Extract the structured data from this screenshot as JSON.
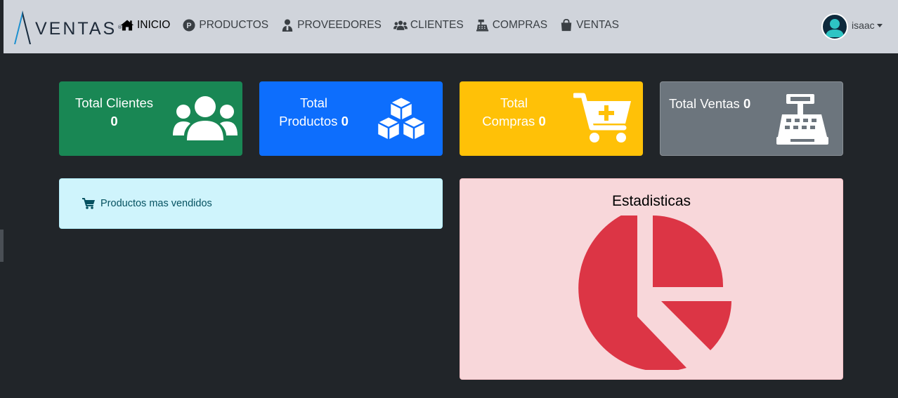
{
  "brand": {
    "name": "VENTAS",
    "registered": "®"
  },
  "nav": {
    "items": [
      {
        "label": "INICIO",
        "icon": "home-icon"
      },
      {
        "label": "PRODUCTOS",
        "icon": "product-p-icon"
      },
      {
        "label": "PROVEEDORES",
        "icon": "supplier-icon"
      },
      {
        "label": "CLIENTES",
        "icon": "users-icon"
      },
      {
        "label": "COMPRAS",
        "icon": "cash-register-icon"
      },
      {
        "label": "VENTAS",
        "icon": "shopping-bag-icon"
      }
    ]
  },
  "user": {
    "name": "isaac"
  },
  "cards": {
    "clientes": {
      "line1": "Total Clientes",
      "value": "0",
      "color": "#198754",
      "icon": "users-icon"
    },
    "productos": {
      "line1": "Total",
      "line2": "Productos",
      "value": "0",
      "color": "#0d6efd",
      "icon": "cubes-icon"
    },
    "compras": {
      "line1": "Total",
      "line2": "Compras",
      "value": "0",
      "color": "#ffc107",
      "icon": "cart-plus-icon"
    },
    "ventas": {
      "line1": "Total Ventas",
      "value": "0",
      "color": "#6c757d",
      "icon": "cash-register-icon"
    }
  },
  "top_products": {
    "label": "Productos mas vendidos",
    "icon": "cart-icon"
  },
  "stats": {
    "title": "Estadisticas",
    "icon": "pie-chart-icon",
    "color": "#dc3545"
  }
}
